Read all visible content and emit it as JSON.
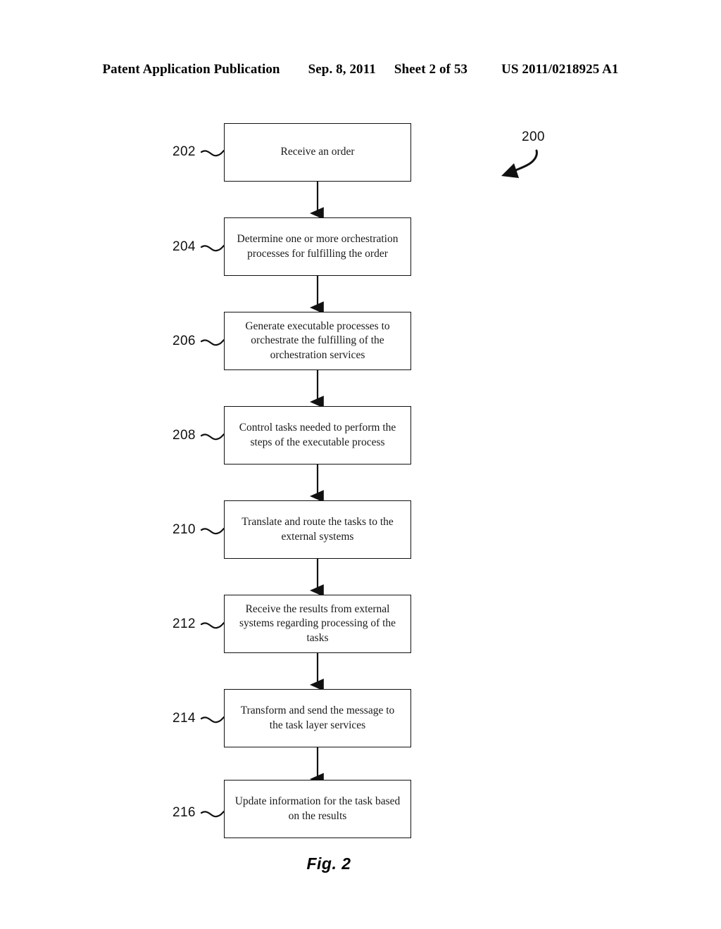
{
  "header": {
    "publication": "Patent Application Publication",
    "date": "Sep. 8, 2011",
    "sheet": "Sheet 2 of 53",
    "patent_number": "US 2011/0218925 A1"
  },
  "figure": {
    "caption": "Fig. 2",
    "diagram_reference": "200",
    "steps": [
      {
        "ref": "202",
        "text": "Receive an order"
      },
      {
        "ref": "204",
        "text": "Determine one or more orchestration processes for fulfilling the order"
      },
      {
        "ref": "206",
        "text": "Generate executable processes to orchestrate the fulfilling of the orchestration services"
      },
      {
        "ref": "208",
        "text": "Control tasks needed to perform the steps of the executable process"
      },
      {
        "ref": "210",
        "text": "Translate and route the tasks to the external systems"
      },
      {
        "ref": "212",
        "text": "Receive the results from external systems regarding processing of the tasks"
      },
      {
        "ref": "214",
        "text": "Transform and send the message to the task layer services"
      },
      {
        "ref": "216",
        "text": "Update information for the task based on the results"
      }
    ]
  },
  "style": {
    "ink_color": "#111111",
    "page_background": "#ffffff"
  }
}
